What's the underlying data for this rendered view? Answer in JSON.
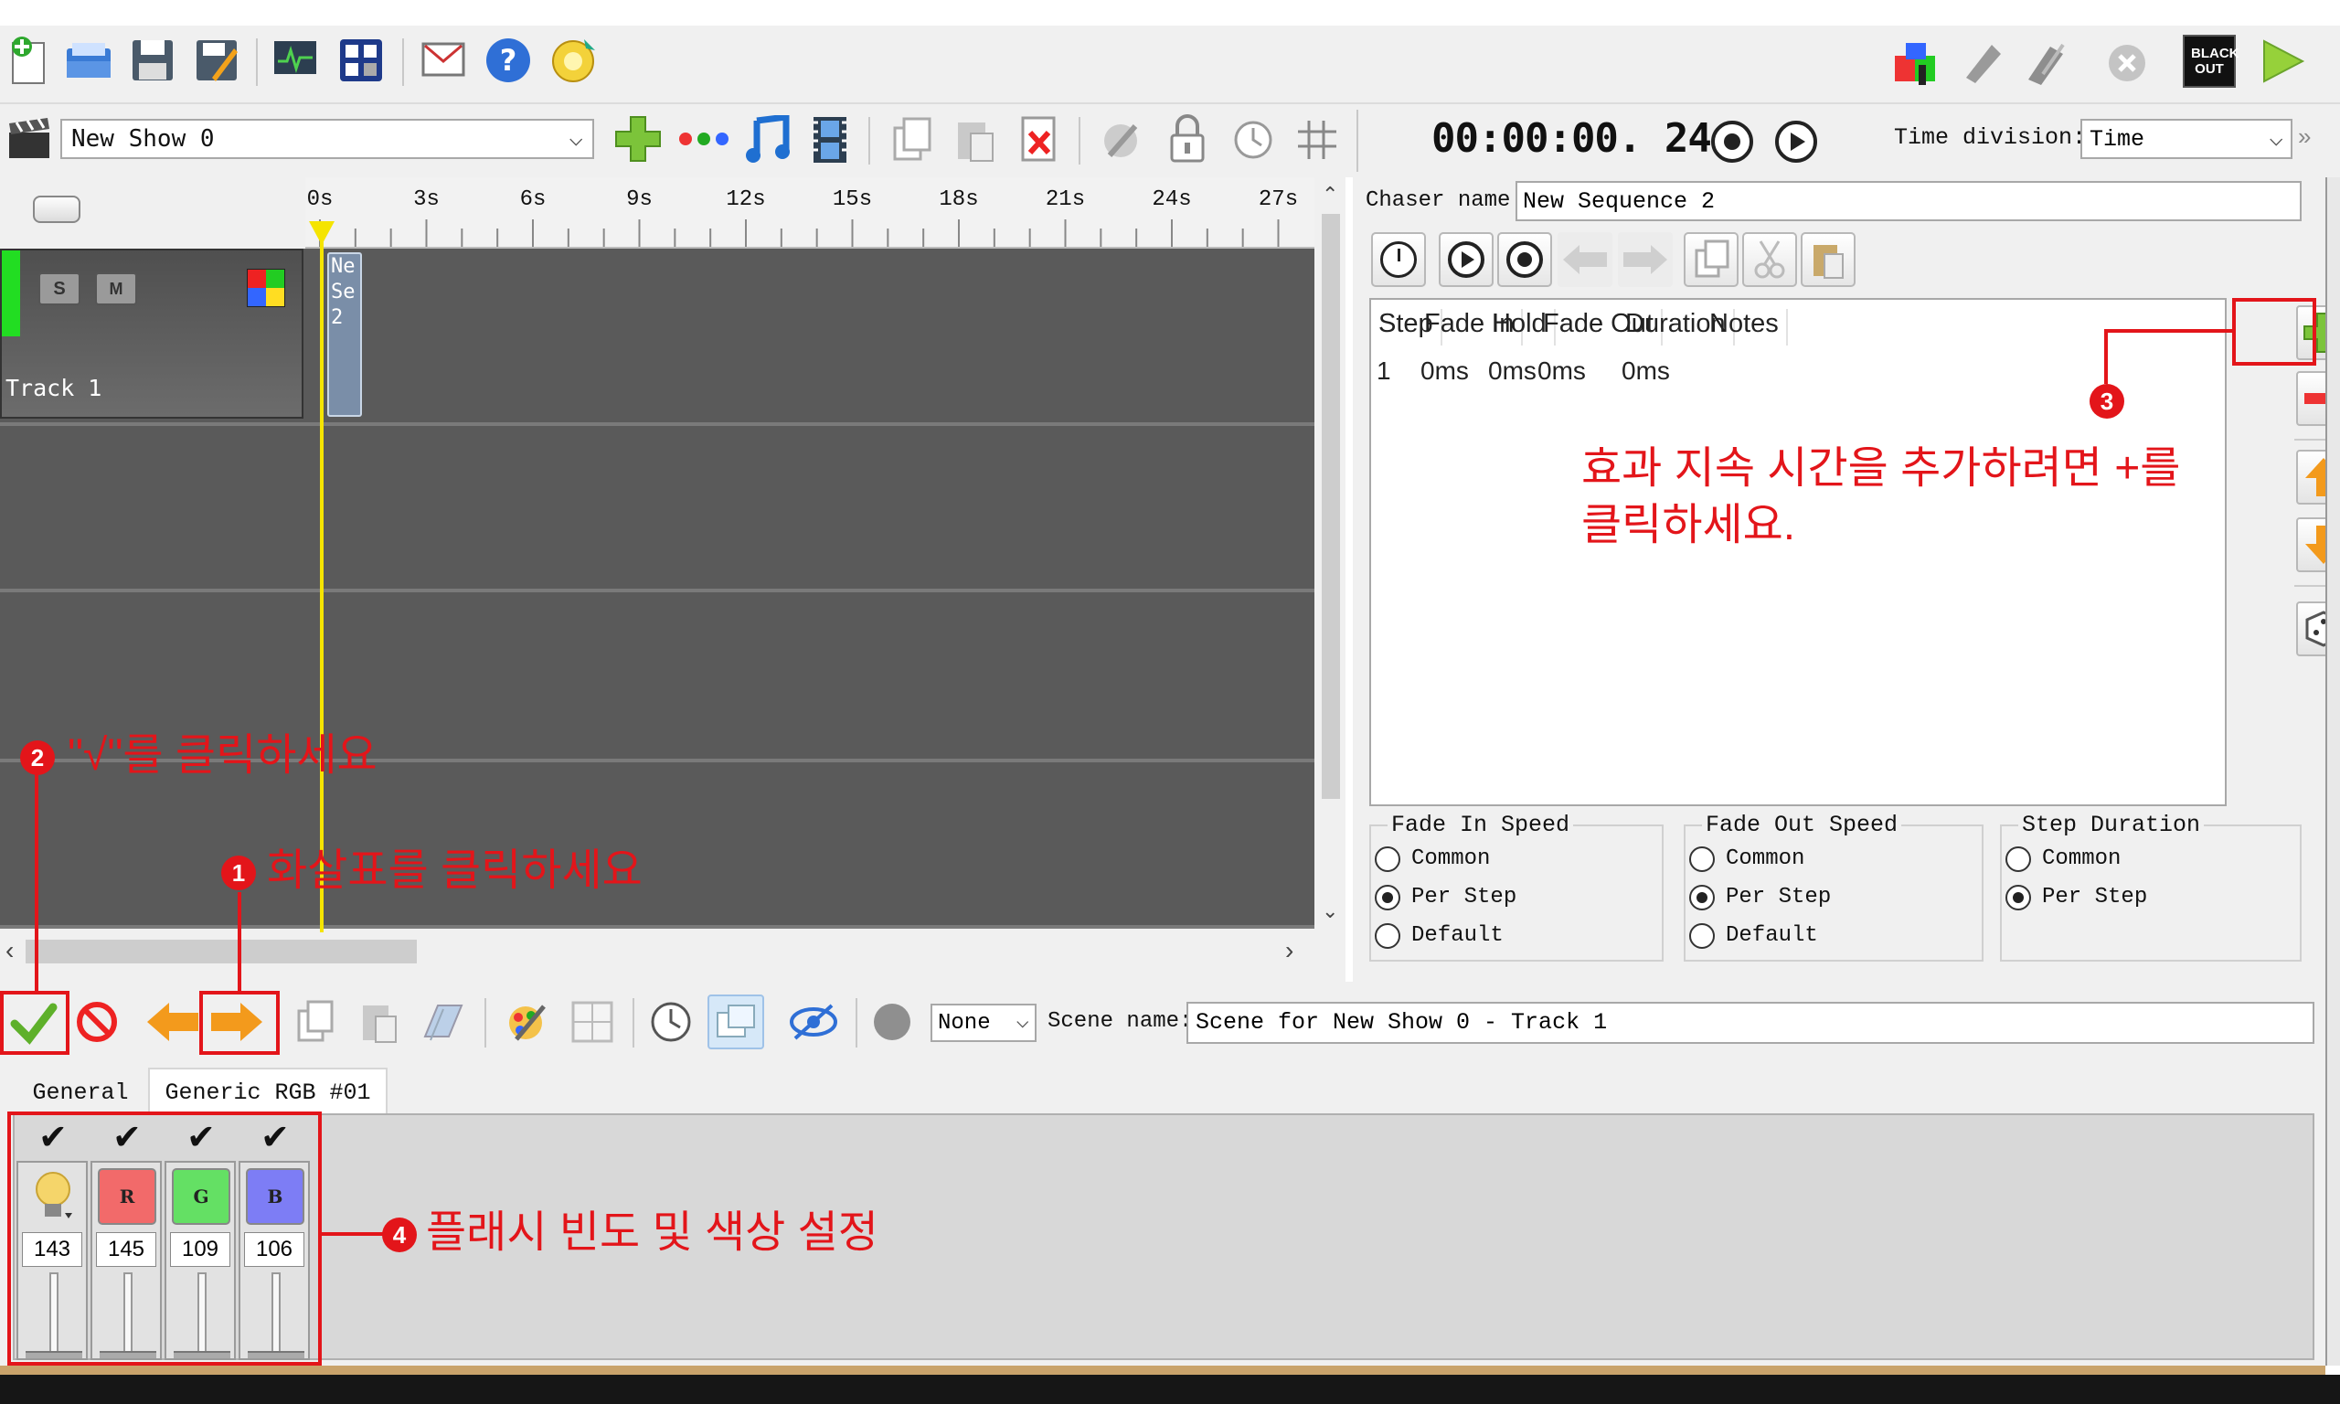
{
  "toolbar_top": {
    "blackout_label": "BLACK OUT"
  },
  "show_bar": {
    "show_name": "New Show 0",
    "timer": "00:00:00. 24",
    "time_division_label": "Time division:",
    "time_division_value": "Time",
    "more": "»"
  },
  "timeline": {
    "ruler_labels": [
      "0s",
      "3s",
      "6s",
      "9s",
      "12s",
      "15s",
      "18s",
      "21s",
      "24s",
      "27s"
    ],
    "track_name": "Track 1",
    "track_buttons": [
      "S",
      "M"
    ],
    "clip_text": [
      "Ne",
      "Se",
      "2"
    ]
  },
  "chaser": {
    "name_label": "Chaser name",
    "name_value": "New Sequence 2",
    "columns": [
      "Step",
      "Fade In",
      "Hold",
      "Fade Out",
      "Duration",
      "Notes"
    ],
    "rows": [
      [
        "1",
        "0ms",
        "0ms",
        "0ms",
        "0ms",
        ""
      ]
    ],
    "groups": [
      {
        "title": "Fade In Speed",
        "options": [
          "Common",
          "Per Step",
          "Default"
        ],
        "selected": "Per Step"
      },
      {
        "title": "Fade Out Speed",
        "options": [
          "Common",
          "Per Step",
          "Default"
        ],
        "selected": "Per Step"
      },
      {
        "title": "Step Duration",
        "options": [
          "Common",
          "Per Step"
        ],
        "selected": "Per Step"
      }
    ]
  },
  "scene_bar": {
    "none_select": "None",
    "scene_name_label": "Scene name:",
    "scene_name_value": "Scene for New Show 0 - Track 1"
  },
  "tabs": [
    "General",
    "Generic RGB #01"
  ],
  "channels": [
    {
      "label": "",
      "value": "143",
      "color": "#f5d56a"
    },
    {
      "label": "R",
      "value": "145",
      "color": "#f26a6a"
    },
    {
      "label": "G",
      "value": "109",
      "color": "#64e064"
    },
    {
      "label": "B",
      "value": "106",
      "color": "#7d7df5"
    }
  ],
  "annotations": {
    "step1_num": "1",
    "step1": "화살표를 클릭하세요",
    "step2_num": "2",
    "step2": "\"√\"를 클릭하세요",
    "step3_num": "3",
    "step3_line1": "효과 지속 시간을 추가하려면 +를",
    "step3_line2": "클릭하세요.",
    "step4_num": "4",
    "step4": "플래시 빈도 및 색상 설정"
  },
  "colors": {
    "accent_red": "#e3151a",
    "track_green": "#22dd22",
    "timeline_bg": "#5a5a5a",
    "cursor_yellow": "#f5e400"
  }
}
